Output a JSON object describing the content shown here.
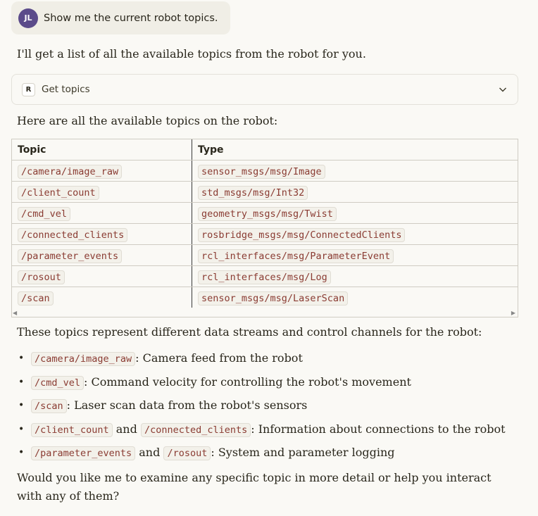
{
  "user": {
    "initials": "JL",
    "message": "Show me the current robot topics."
  },
  "intro": "I'll get a list of all the available topics from the robot for you.",
  "tool": {
    "badge": "R",
    "label": "Get topics",
    "icon": "chevron-down-icon"
  },
  "table_intro": "Here are all the available topics on the robot:",
  "table": {
    "headers": [
      "Topic",
      "Type"
    ],
    "rows": [
      [
        "/camera/image_raw",
        "sensor_msgs/msg/Image"
      ],
      [
        "/client_count",
        "std_msgs/msg/Int32"
      ],
      [
        "/cmd_vel",
        "geometry_msgs/msg/Twist"
      ],
      [
        "/connected_clients",
        "rosbridge_msgs/msg/ConnectedClients"
      ],
      [
        "/parameter_events",
        "rcl_interfaces/msg/ParameterEvent"
      ],
      [
        "/rosout",
        "rcl_interfaces/msg/Log"
      ],
      [
        "/scan",
        "sensor_msgs/msg/LaserScan"
      ]
    ]
  },
  "summary_intro": "These topics represent different data streams and control channels for the robot:",
  "bullets": [
    {
      "code1": "/camera/image_raw",
      "text": ": Camera feed from the robot"
    },
    {
      "code1": "/cmd_vel",
      "text": ": Command velocity for controlling the robot's movement"
    },
    {
      "code1": "/scan",
      "text": ": Laser scan data from the robot's sensors"
    },
    {
      "code1": "/client_count",
      "and": " and ",
      "code2": "/connected_clients",
      "text": ": Information about connections to the robot"
    },
    {
      "code1": "/parameter_events",
      "and": " and ",
      "code2": "/rosout",
      "text": ": System and parameter logging"
    }
  ],
  "closing": "Would you like me to examine any specific topic in more detail or help you interact with any of them?"
}
